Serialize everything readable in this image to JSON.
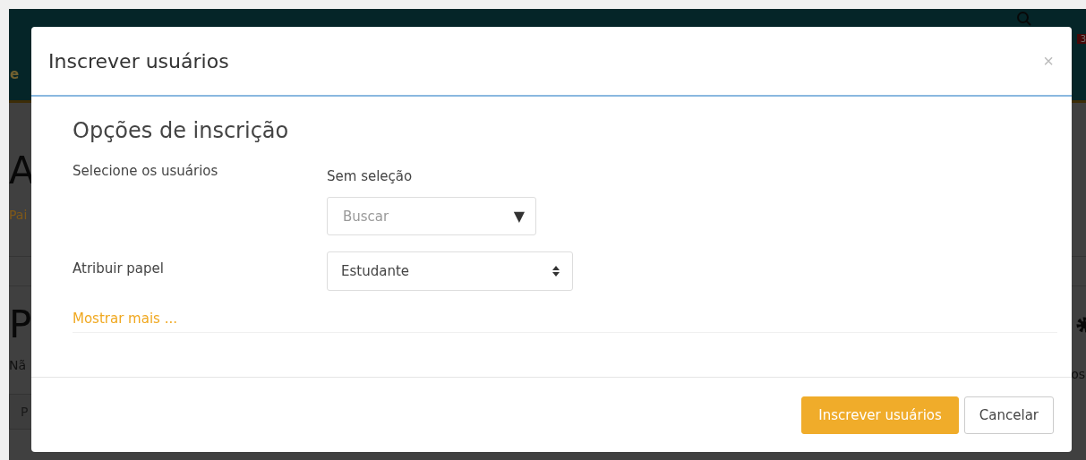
{
  "background_page": {
    "header": {
      "site_name": "e",
      "notification_count": "3"
    },
    "page_title": "A",
    "breadcrumb": "Pai",
    "section_title": "P",
    "section_text": "Nã",
    "filter_field": {
      "value": "P"
    },
    "right_text": "os"
  },
  "dialog": {
    "title": "Inscrever usuários",
    "close": "×",
    "section_title": "Opções de inscrição",
    "fields": [
      {
        "kind": "autocomplete",
        "label": "Selecione os usuários",
        "selection": "Sem seleção",
        "placeholder": "Buscar",
        "arrow": "▼"
      },
      {
        "kind": "select",
        "label": "Atribuir papel",
        "value": "Estudante"
      }
    ],
    "show_more": "Mostrar mais ...",
    "buttons": [
      {
        "label": "Inscrever usuários",
        "primary": true
      },
      {
        "label": "Cancelar",
        "primary": false
      }
    ]
  }
}
